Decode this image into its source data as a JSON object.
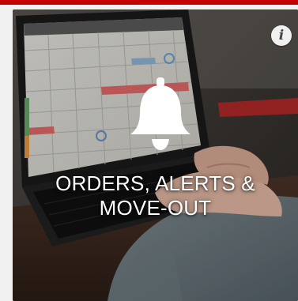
{
  "tile": {
    "title_line1": "ORDERS, ALERTS &",
    "title_line2": "MOVE-OUT",
    "info_icon_glyph": "i",
    "icon": "bell-icon",
    "background_image": "laptop-calendar-photo"
  },
  "colors": {
    "accent": "#c40000",
    "label": "#ffffff",
    "page_background": "#f1f1f1"
  }
}
